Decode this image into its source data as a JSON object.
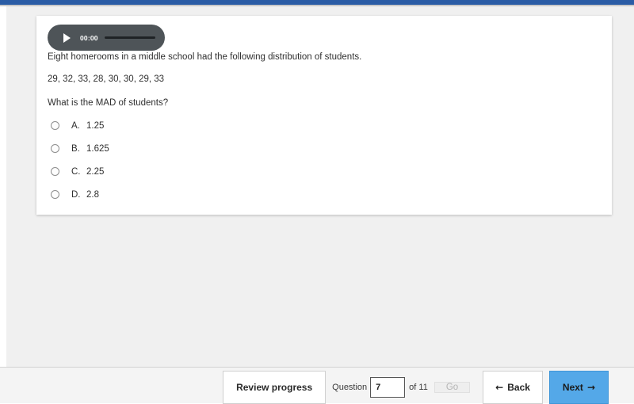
{
  "chrome": {
    "top_bar_color": "#2a5ca5"
  },
  "question_card": {
    "audio": {
      "time": "00:00",
      "play_icon": "play-triangle-icon",
      "progress_percent": 0,
      "background_color": "#4e5458"
    },
    "stem": "Eight homerooms in a middle school had the following distribution of students.",
    "data_values": "29, 32, 33, 28, 30, 30, 29, 33",
    "prompt": "What is the MAD of students?",
    "options": [
      {
        "letter": "A.",
        "value": "1.25",
        "selected": false
      },
      {
        "letter": "B.",
        "value": "1.625",
        "selected": false
      },
      {
        "letter": "C.",
        "value": "2.25",
        "selected": false
      },
      {
        "letter": "D.",
        "value": "2.8",
        "selected": false
      }
    ]
  },
  "footer": {
    "review_label": "Review progress",
    "question_label": "Question",
    "question_number": "7",
    "question_placeholder": "",
    "of_label": "of 11",
    "go_label": "Go",
    "go_disabled": true,
    "back_label": "Back",
    "back_arrow": "←",
    "next_label": "Next",
    "next_arrow": "→",
    "next_color": "#54a8e8"
  }
}
